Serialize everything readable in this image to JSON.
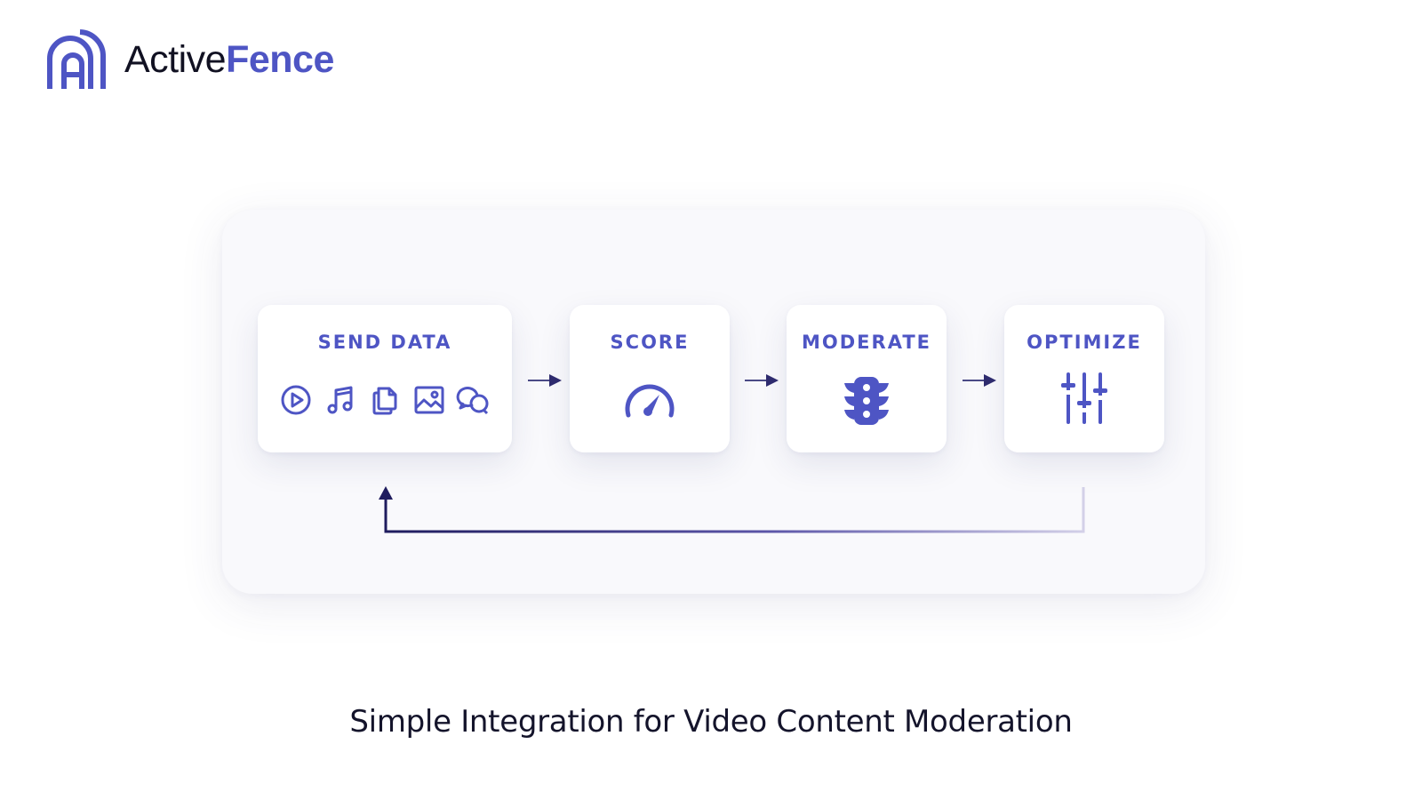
{
  "brand": {
    "name_part1": "Active",
    "name_part2": "Fence",
    "primary_color": "#4e55c4",
    "icon": "activefence-logo-mark"
  },
  "diagram": {
    "steps": [
      {
        "label": "SEND DATA",
        "icons": [
          "play-circle-icon",
          "music-note-icon",
          "documents-icon",
          "image-icon",
          "chat-bubbles-icon"
        ]
      },
      {
        "label": "SCORE",
        "icons": [
          "gauge-icon"
        ]
      },
      {
        "label": "MODERATE",
        "icons": [
          "traffic-light-icon"
        ]
      },
      {
        "label": "OPTIMIZE",
        "icons": [
          "sliders-icon"
        ]
      }
    ],
    "feedback_loop": {
      "from": "OPTIMIZE",
      "to": "SEND DATA"
    }
  },
  "caption": "Simple Integration for Video Content Moderation"
}
